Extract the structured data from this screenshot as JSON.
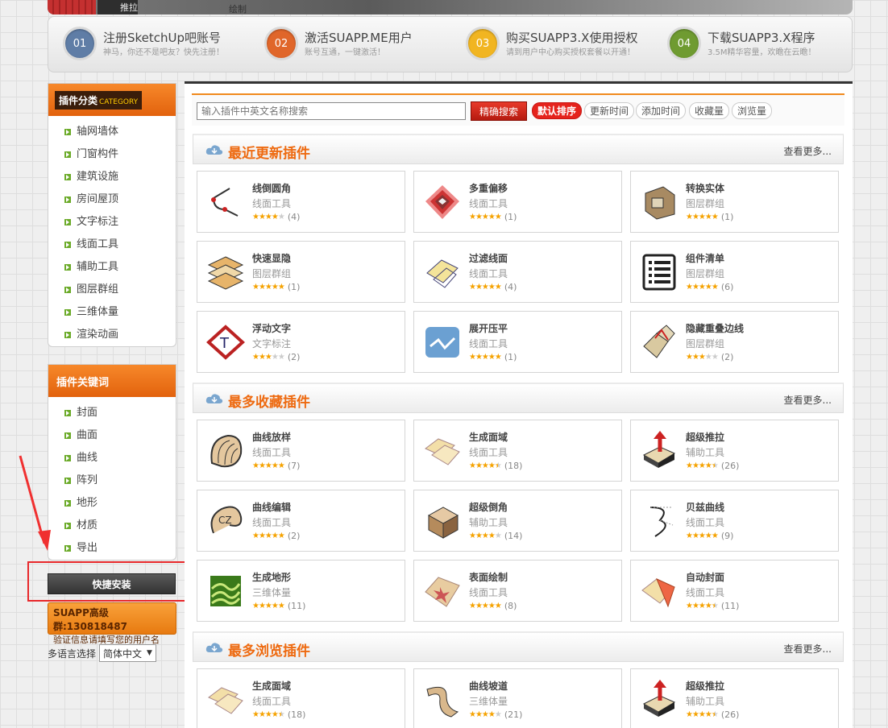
{
  "banner": {
    "label1": "推拉",
    "label2": "绘制"
  },
  "steps": [
    {
      "num": "01",
      "title": "注册SketchUp吧账号",
      "sub": "神马，你还不是吧友？快先注册！",
      "color": "#5f7da6"
    },
    {
      "num": "02",
      "title": "激活SUAPP.ME用户",
      "sub": "账号互通，一键激活！",
      "color": "#e0662a"
    },
    {
      "num": "03",
      "title": "购买SUAPP3.X使用授权",
      "sub": "请到用户中心购买授权套餐以开通！",
      "color": "#f1b521"
    },
    {
      "num": "04",
      "title": "下载SUAPP3.X程序",
      "sub": "3.5M精华容量，欢瞻在云瞻！",
      "color": "#6f9b31"
    }
  ],
  "sidebar": {
    "category_title": "插件分类",
    "category_title_en": "CATEGORY",
    "categories": [
      "轴网墙体",
      "门窗构件",
      "建筑设施",
      "房间屋顶",
      "文字标注",
      "线面工具",
      "辅助工具",
      "图层群组",
      "三维体量",
      "渲染动画"
    ],
    "keyword_title": "插件关键词",
    "keywords": [
      "封面",
      "曲面",
      "曲线",
      "阵列",
      "地形",
      "材质",
      "导出"
    ],
    "quick_install": "快捷安装",
    "group_line1": "SUAPP高级群:130818487",
    "group_line2": "验证信息请填写您的用户名",
    "lang_label": "多语言选择",
    "lang_value": "简体中文"
  },
  "search": {
    "placeholder": "输入插件中英文名称搜索",
    "button": "精确搜索",
    "sort_tabs": [
      "默认排序",
      "更新时间",
      "添加时间",
      "收藏量",
      "浏览量"
    ]
  },
  "sections": [
    {
      "title": "最近更新插件",
      "more": "查看更多...",
      "items": [
        {
          "name": "线倒圆角",
          "cat": "线面工具",
          "stars": 4,
          "count": "(4)",
          "icon": "fillet-line-icon"
        },
        {
          "name": "多重偏移",
          "cat": "线面工具",
          "stars": 5,
          "count": "(1)",
          "icon": "multi-offset-icon"
        },
        {
          "name": "转换实体",
          "cat": "图层群组",
          "stars": 5,
          "count": "(1)",
          "icon": "convert-solid-icon"
        },
        {
          "name": "快速显隐",
          "cat": "图层群组",
          "stars": 5,
          "count": "(1)",
          "icon": "layers-toggle-icon"
        },
        {
          "name": "过滤线面",
          "cat": "线面工具",
          "stars": 5,
          "count": "(4)",
          "icon": "filter-faces-icon"
        },
        {
          "name": "组件清单",
          "cat": "图层群组",
          "stars": 5,
          "count": "(6)",
          "icon": "component-list-icon"
        },
        {
          "name": "浮动文字",
          "cat": "文字标注",
          "stars": 3,
          "count": "(2)",
          "icon": "floating-text-icon"
        },
        {
          "name": "展开压平",
          "cat": "线面工具",
          "stars": 5,
          "count": "(1)",
          "icon": "unfold-flatten-icon"
        },
        {
          "name": "隐藏重叠边线",
          "cat": "图层群组",
          "stars": 3,
          "count": "(2)",
          "icon": "hide-overlap-edges-icon"
        }
      ]
    },
    {
      "title": "最多收藏插件",
      "more": "查看更多...",
      "items": [
        {
          "name": "曲线放样",
          "cat": "线面工具",
          "stars": 5,
          "count": "(7)",
          "icon": "curve-loft-icon"
        },
        {
          "name": "生成面域",
          "cat": "线面工具",
          "stars": 4.5,
          "count": "(18)",
          "icon": "make-faces-icon"
        },
        {
          "name": "超级推拉",
          "cat": "辅助工具",
          "stars": 4.5,
          "count": "(26)",
          "icon": "super-pushpull-icon"
        },
        {
          "name": "曲线编辑",
          "cat": "线面工具",
          "stars": 5,
          "count": "(2)",
          "icon": "curve-edit-icon"
        },
        {
          "name": "超级倒角",
          "cat": "辅助工具",
          "stars": 4,
          "count": "(14)",
          "icon": "super-bevel-icon"
        },
        {
          "name": "贝兹曲线",
          "cat": "线面工具",
          "stars": 5,
          "count": "(9)",
          "icon": "bezier-curve-icon"
        },
        {
          "name": "生成地形",
          "cat": "三维体量",
          "stars": 5,
          "count": "(11)",
          "icon": "terrain-icon"
        },
        {
          "name": "表面绘制",
          "cat": "线面工具",
          "stars": 5,
          "count": "(8)",
          "icon": "surface-draw-icon"
        },
        {
          "name": "自动封面",
          "cat": "线面工具",
          "stars": 4.5,
          "count": "(11)",
          "icon": "auto-face-icon"
        }
      ]
    },
    {
      "title": "最多浏览插件",
      "more": "查看更多...",
      "items": [
        {
          "name": "生成面域",
          "cat": "线面工具",
          "stars": 4.5,
          "count": "(18)",
          "icon": "make-faces-icon"
        },
        {
          "name": "曲线坡道",
          "cat": "三维体量",
          "stars": 4,
          "count": "(21)",
          "icon": "curve-ramp-icon"
        },
        {
          "name": "超级推拉",
          "cat": "辅助工具",
          "stars": 4.5,
          "count": "(26)",
          "icon": "super-pushpull-icon"
        }
      ]
    }
  ]
}
